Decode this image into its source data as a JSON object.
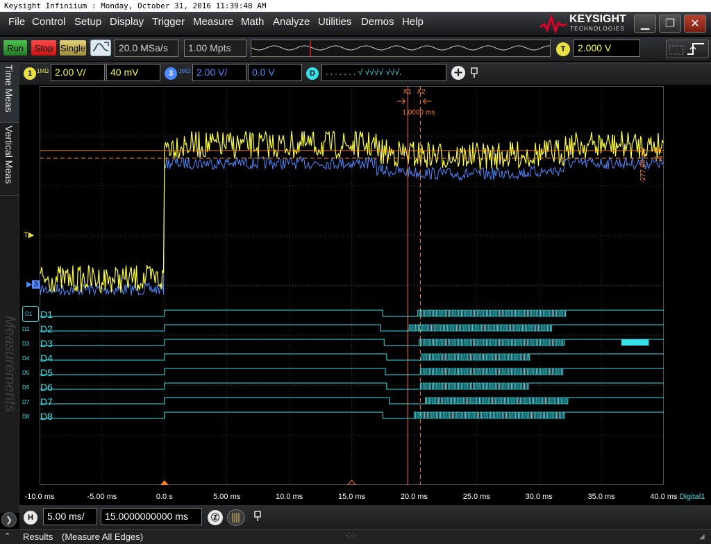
{
  "window": {
    "title": "Keysight Infiniium : Monday, October 31, 2016 11:39:48 AM"
  },
  "menu": [
    {
      "label": "File",
      "name": "menu-file"
    },
    {
      "label": "Control",
      "name": "menu-control"
    },
    {
      "label": "Setup",
      "name": "menu-setup"
    },
    {
      "label": "Display",
      "name": "menu-display"
    },
    {
      "label": "Trigger",
      "name": "menu-trigger"
    },
    {
      "label": "Measure",
      "name": "menu-measure"
    },
    {
      "label": "Math",
      "name": "menu-math"
    },
    {
      "label": "Analyze",
      "name": "menu-analyze"
    },
    {
      "label": "Utilities",
      "name": "menu-utilities"
    },
    {
      "label": "Demos",
      "name": "menu-demos"
    },
    {
      "label": "Help",
      "name": "menu-help"
    }
  ],
  "brand": {
    "name": "KEYSIGHT",
    "sub": "TECHNOLOGIES",
    "color": "#e4002b"
  },
  "toolbar": {
    "run": "Run",
    "stop": "Stop",
    "single": "Single",
    "sample_rate": "20.0 MSa/s",
    "memory_depth": "1.00 Mpts",
    "trigger_badge": "T",
    "trigger_level": "2.000 V"
  },
  "channels": {
    "ch1": {
      "badge": "1",
      "impedance": "1MΩ",
      "scale": "2.00 V/",
      "offset": "40 mV",
      "color": "#ffff3c"
    },
    "ch3": {
      "badge": "3",
      "impedance": "1MΩ",
      "scale": "2.00 V/",
      "offset": "0.0 V",
      "color": "#4f88ff"
    },
    "digital": {
      "badge": "D",
      "activity": ". . . .   . . . √  √√√√  √√√."
    }
  },
  "left_tabs": {
    "time_meas": "Time Meas",
    "vertical_meas": "Vertical Meas",
    "measurements": "Measurements"
  },
  "markers": {
    "x1": "X1",
    "x2": "X2",
    "delta": "1.0000 ms",
    "y_delta": "-277.80 mV",
    "y1": "Y1",
    "y2": "Y2",
    "trigger": "T",
    "ch3_ground": "3",
    "color": "#ff7f1e"
  },
  "digital_labels": [
    "D1",
    "D2",
    "D3",
    "D4",
    "D5",
    "D6",
    "D7",
    "D8"
  ],
  "x_axis": {
    "ticks": [
      "-10.0 ms",
      "-5.00 ms",
      "0.0 s",
      "5.00 ms",
      "10.0 ms",
      "15.0 ms",
      "20.0 ms",
      "25.0 ms",
      "30.0 ms",
      "35.0 ms",
      "40.0 ms"
    ],
    "source": "Digital1"
  },
  "horizontal": {
    "badge": "H",
    "scale": "5.00 ms/",
    "position": "15.0000000000 ms"
  },
  "status": {
    "results": "Results",
    "mode": "(Measure All Edges)"
  }
}
